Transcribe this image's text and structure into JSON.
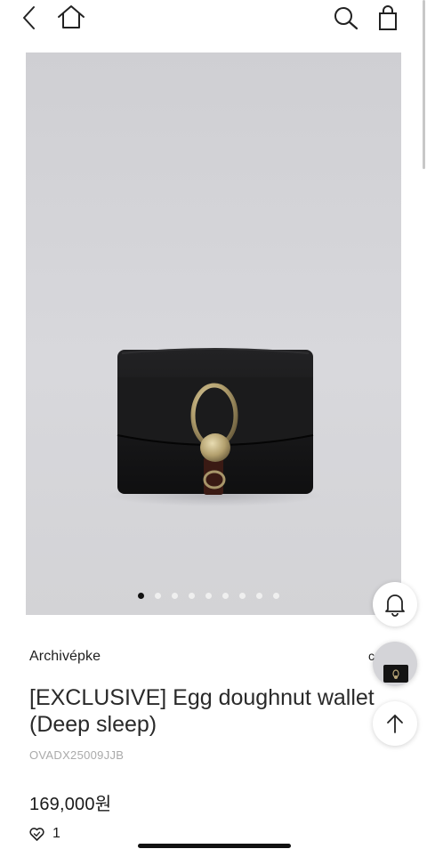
{
  "nav": {
    "back_icon": "chevron-left-icon",
    "home_icon": "home-icon",
    "search_icon": "search-icon",
    "cart_icon": "shopping-bag-icon"
  },
  "carousel": {
    "total": 9,
    "active_index": 0
  },
  "product": {
    "brand": "Archivépke",
    "brand_extra": "c",
    "title": "[EXCLUSIVE] Egg doughnut wallet(Deep sleep)",
    "code": "OVADX25009JJB",
    "price": "169,000원",
    "likes": "1"
  },
  "floating": {
    "notify_icon": "bell-icon",
    "scroll_top_icon": "arrow-up-icon"
  },
  "colors": {
    "background": "#ffffff",
    "image_bg": "#d5d5d9",
    "wallet": "#141414",
    "clasp": "#b9a677",
    "active_dot": "#111111",
    "inactive_dot": "#efefef"
  }
}
